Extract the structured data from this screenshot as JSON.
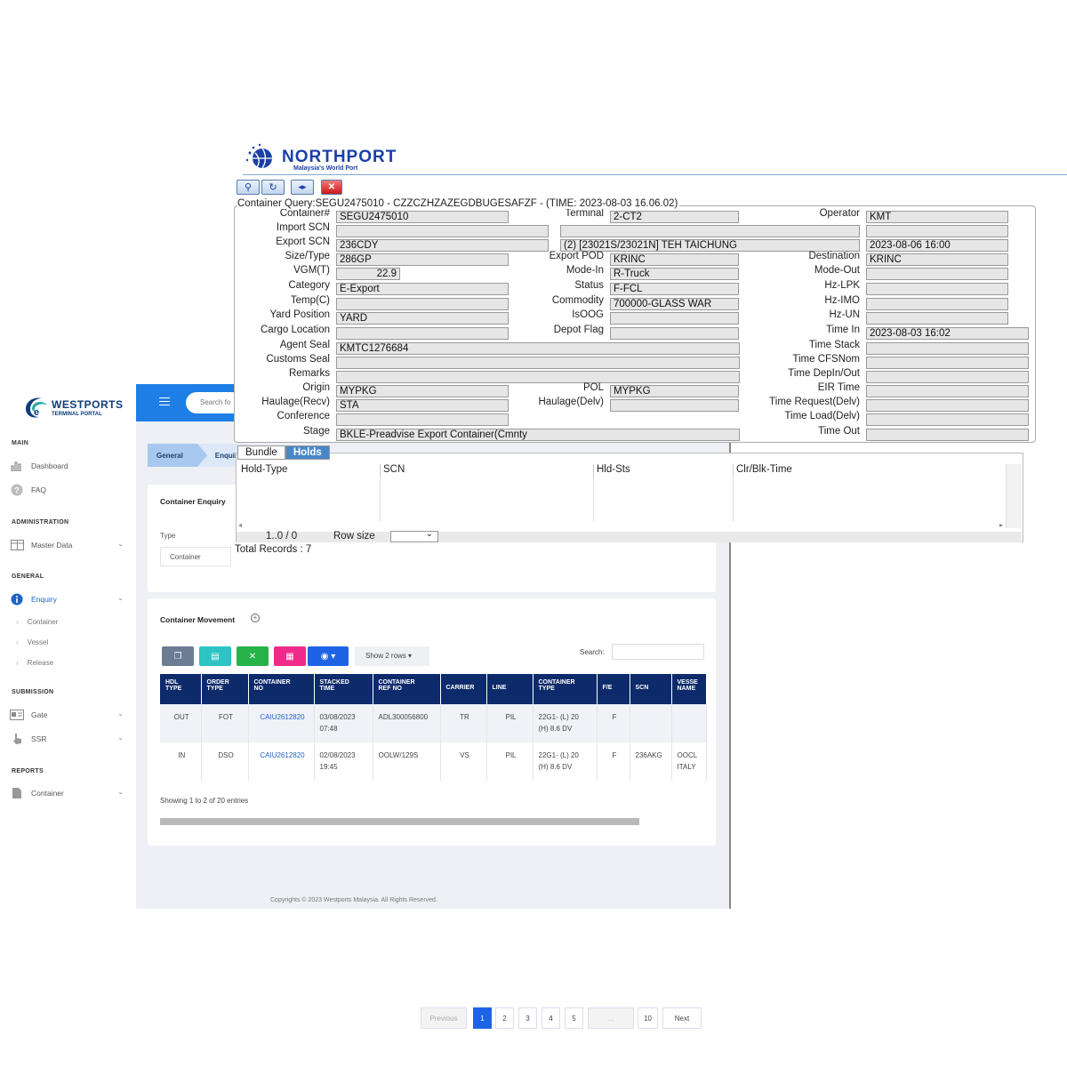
{
  "westports": {
    "logo": {
      "title": "WESTPORTS",
      "subtitle": "TERMINAL PORTAL"
    },
    "search_placeholder": "Search fo",
    "sections": {
      "main": "MAIN",
      "administration": "ADMINISTRATION",
      "general": "GENERAL",
      "submission": "SUBMISSION",
      "reports": "REPORTS"
    },
    "nav": {
      "dashboard": "Dashboard",
      "faq": "FAQ",
      "master_data": "Master Data",
      "enquiry": "Enquiry",
      "enquiry_sub": [
        "Container",
        "Vessel",
        "Release"
      ],
      "gate": "Gate",
      "ssr": "SSR",
      "report_container": "Container"
    },
    "breadcrumb": [
      "General",
      "Enquir"
    ],
    "enquiry_card": {
      "title": "Container Enquiry",
      "type_label": "Type",
      "type_value": "Container"
    },
    "movement": {
      "title": "Container Movement",
      "show_rows": "Show 2 rows ▾",
      "search_label": "Search:",
      "columns": [
        [
          "HDL",
          "TYPE"
        ],
        [
          "ORDER",
          "TYPE"
        ],
        [
          "CONTAINER",
          "NO"
        ],
        [
          "STACKED",
          "TIME"
        ],
        [
          "CONTAINER",
          "REF NO"
        ],
        [
          "CARRIER",
          ""
        ],
        [
          "LINE",
          ""
        ],
        [
          "CONTAINER",
          "TYPE"
        ],
        [
          "F/E",
          ""
        ],
        [
          "SCN",
          ""
        ],
        [
          "VESSE",
          "NAME"
        ]
      ],
      "rows": [
        {
          "hdl": "OUT",
          "order": "FOT",
          "container": "CAIU2612820",
          "stacked": [
            "03/08/2023",
            "07:48"
          ],
          "ref": "ADL300056800",
          "carrier": "TR",
          "line": "PIL",
          "ctype": [
            "22G1- (L) 20",
            "(H) 8.6 DV"
          ],
          "fe": "F",
          "scn": "",
          "vessel": [
            "",
            ""
          ]
        },
        {
          "hdl": "IN",
          "order": "DSO",
          "container": "CAIU2612820",
          "stacked": [
            "02/08/2023",
            "19:45"
          ],
          "ref": "OOLW/129S",
          "carrier": "VS",
          "line": "PIL",
          "ctype": [
            "22G1- (L) 20",
            "(H) 8.6 DV"
          ],
          "fe": "F",
          "scn": "236AKG",
          "vessel": [
            "OOCL",
            "ITALY"
          ]
        }
      ],
      "showing": "Showing 1 to 2 of 20 entries",
      "pagination": {
        "previous": "Previous",
        "pages": [
          "1",
          "2",
          "3",
          "4",
          "5",
          "...",
          "10"
        ],
        "next": "Next",
        "active": "1"
      }
    },
    "footer": "Copyrights © 2023 Westports Malaysia. All Rights Reserved."
  },
  "northport": {
    "logo": {
      "title": "NORTHPORT",
      "subtitle": "Malaysia's World Port"
    },
    "query_title": "Container Query:SEGU2475010 - CZZCZHZAZEGDBUGESAFZF - (TIME: 2023-08-03 16.06.02)",
    "labels": {
      "container": "Container#",
      "import_scn": "Import SCN",
      "export_scn": "Export SCN",
      "size_type": "Size/Type",
      "vgm": "VGM(T)",
      "category": "Category",
      "temp": "Temp(C)",
      "yard_position": "Yard Position",
      "cargo_location": "Cargo Location",
      "agent_seal": "Agent Seal",
      "customs_seal": "Customs Seal",
      "remarks": "Remarks",
      "origin": "Origin",
      "haulage_recv": "Haulage(Recv)",
      "conference": "Conference",
      "stage": "Stage",
      "terminal": "Terminal",
      "export_pod": "Export POD",
      "mode_in": "Mode-In",
      "status": "Status",
      "commodity": "Commodity",
      "isoog": "IsOOG",
      "depot_flag": "Depot Flag",
      "pol": "POL",
      "haulage_delv": "Haulage(Delv)",
      "operator": "Operator",
      "destination": "Destination",
      "mode_out": "Mode-Out",
      "hz_lpk": "Hz-LPK",
      "hz_imo": "Hz-IMO",
      "hz_un": "Hz-UN",
      "time_in": "Time In",
      "time_stack": "Time Stack",
      "time_cfsnom": "Time CFSNom",
      "time_depin_out": "Time DepIn/Out",
      "eir_time": "EIR Time",
      "time_request_delv": "Time Request(Delv)",
      "time_load_delv": "Time Load(Delv)",
      "time_out": "Time Out"
    },
    "values": {
      "container": "SEGU2475010",
      "import_scn": "",
      "export_scn": "236CDY",
      "size_type": "286GP",
      "vgm": "22.9",
      "category": "E-Export",
      "temp": "",
      "yard_position": "YARD",
      "cargo_location": "",
      "agent_seal": "KMTC1276684",
      "customs_seal": "",
      "remarks": "",
      "origin": "MYPKG",
      "haulage_recv": "STA",
      "conference": "",
      "stage": "BKLE-Preadvise Export Container(Cmnty",
      "terminal": "2-CT2",
      "import_vessel": "",
      "export_vessel": "(2) [23021S/23021N] TEH TAICHUNG",
      "export_pod": "KRINC",
      "mode_in": "R-Truck",
      "status": "F-FCL",
      "commodity": "700000-GLASS WAR",
      "isoog": "",
      "depot_flag": "",
      "pol": "MYPKG",
      "haulage_delv": "",
      "operator": "KMT",
      "import_eta": "",
      "export_eta": "2023-08-06 16:00",
      "destination": "KRINC",
      "mode_out": "",
      "hz_lpk": "",
      "hz_imo": "",
      "hz_un": "",
      "time_in": "2023-08-03 16:02",
      "time_stack": "",
      "time_cfsnom": "",
      "time_depin_out": "",
      "eir_time": "",
      "time_request_delv": "",
      "time_load_delv": "",
      "time_out": ""
    },
    "tabs": [
      "Bundle",
      "Holds"
    ],
    "grid_columns": [
      "Hold-Type",
      "SCN",
      "Hld-Sts",
      "Clr/Blk-Time"
    ],
    "pager": "1..0 / 0",
    "row_size_label": "Row size",
    "total_records": "Total Records : 7"
  },
  "colors": {
    "westports_blue": "#1e7ee6",
    "table_header": "#0d2a6b",
    "northport_blue": "#1b3fa8",
    "holds_tab": "#4a86c8"
  }
}
